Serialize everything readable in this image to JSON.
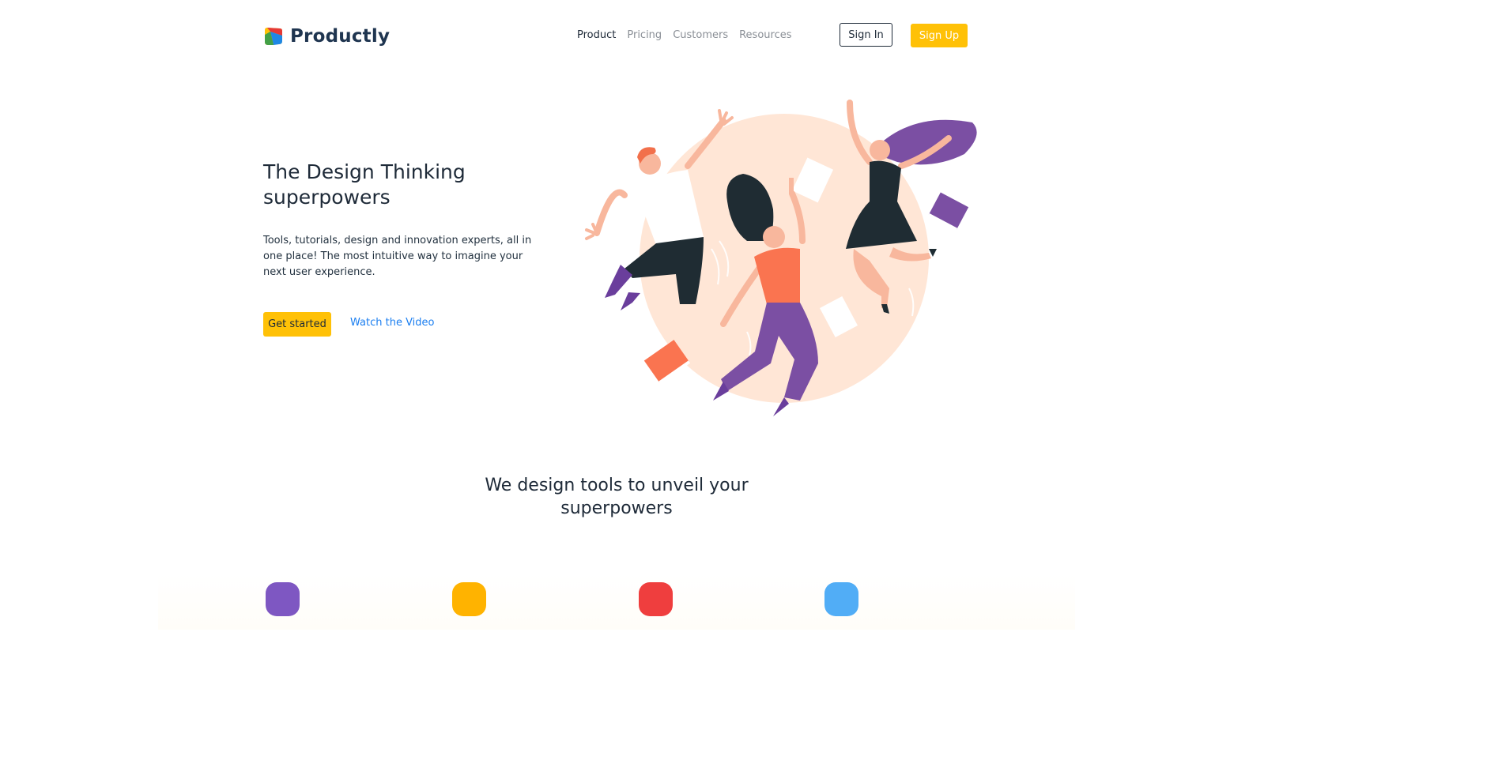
{
  "brand": {
    "name": "Productly",
    "logo_colors": [
      "#e53935",
      "#ffc107",
      "#43a047",
      "#1e88e5"
    ]
  },
  "nav": {
    "items": [
      {
        "label": "Product",
        "active": true
      },
      {
        "label": "Pricing",
        "active": false
      },
      {
        "label": "Customers",
        "active": false
      },
      {
        "label": "Resources",
        "active": false
      }
    ],
    "sign_in": "Sign In",
    "sign_up": "Sign Up"
  },
  "hero": {
    "title": "The Design Thinking superpowers",
    "text": "Tools, tutorials, design and innovation experts, all in one place! The most intuitive way to imagine your next user experience.",
    "cta_primary": "Get started",
    "cta_secondary": "Watch the Video",
    "illustration": "three-people-jumping-illustration"
  },
  "features": {
    "title": "We design tools to unveil your superpowers",
    "icons": [
      {
        "name": "purple-feature-icon",
        "color": "#7e57c2"
      },
      {
        "name": "yellow-feature-icon",
        "color": "#ffb300"
      },
      {
        "name": "red-feature-icon",
        "color": "#ef3e3e"
      },
      {
        "name": "blue-feature-icon",
        "color": "#51adf6"
      }
    ]
  },
  "colors": {
    "accent": "#ffc107",
    "link": "#1a7ef0",
    "text": "#1e2a38",
    "muted": "#8a8f96"
  }
}
